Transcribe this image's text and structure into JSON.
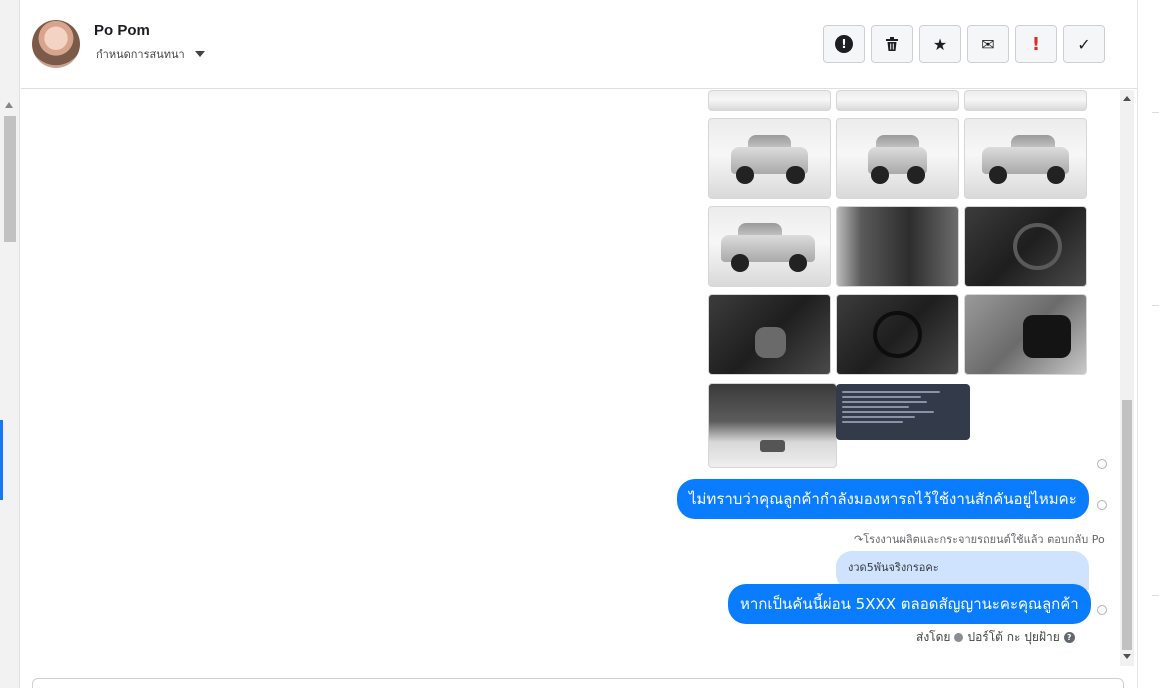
{
  "header": {
    "contact_name": "Po Pom",
    "assign_label": "กำหนดการสนทนา",
    "actions": [
      {
        "icon": "spam-report-icon",
        "glyph": "!"
      },
      {
        "icon": "trash-icon",
        "glyph": "🗑"
      },
      {
        "icon": "star-icon",
        "glyph": "★"
      },
      {
        "icon": "envelope-icon",
        "glyph": "✉"
      },
      {
        "icon": "follow-up-icon",
        "glyph": "!"
      },
      {
        "icon": "checkmark-icon",
        "glyph": "✓"
      }
    ]
  },
  "messages": {
    "message_1": "ไม่ทราบว่าคุณลูกค้ากำลังมองหารถไว้ใช้งานสักคันอยู่ไหมคะ",
    "reply_note": "โรงงานผลิตและกระจายรถยนต์ใช้แล้ว ตอบกลับ Po",
    "quoted_text": "งวด5พันจริงกรอคะ",
    "message_2": "หากเป็นคันนี้ผ่อน 5XXX ตลอดสัญญานะคะคุณลูกค้า",
    "sent_by_label": "ส่งโดย",
    "sender_name": "ปอร์โต้ กะ ปุยฝ้าย",
    "help_glyph": "?"
  },
  "colors": {
    "bubble_blue": "#0a7cff",
    "quote_bg": "#cfe3ff",
    "follow_up_red": "#d93025"
  }
}
